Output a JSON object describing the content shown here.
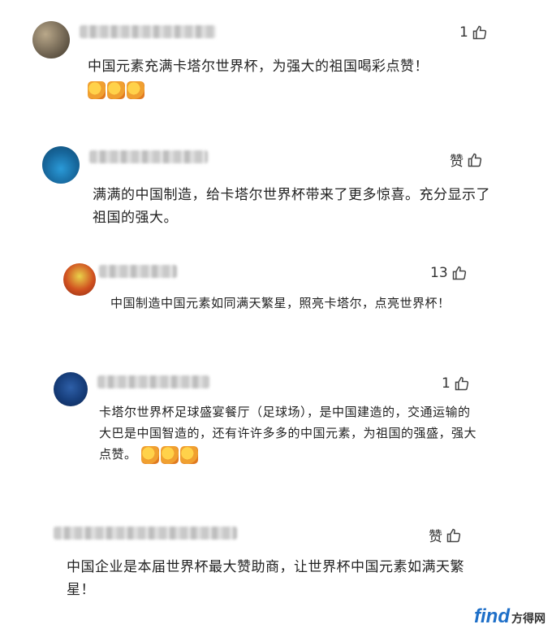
{
  "comments": [
    {
      "likes": "1",
      "text": "中国元素充满卡塔尔世界杯，为强大的祖国喝彩点赞！",
      "emoji": [
        "thumbs-up-emoji",
        "thumbs-up-emoji",
        "thumbs-up-emoji"
      ]
    },
    {
      "likes": "赞",
      "text": "满满的中国制造，给卡塔尔世界杯带来了更多惊喜。充分显示了祖国的强大。"
    },
    {
      "likes": "13",
      "text": "中国制造中国元素如同满天繁星，照亮卡塔尔，点亮世界杯！"
    },
    {
      "likes": "1",
      "text": "卡塔尔世界杯足球盛宴餐厅（足球场），是中国建造的，交通运输的大巴是中国智造的，还有许许多多的中国元素，为祖国的强盛，强大点赞。",
      "emoji": [
        "thumbs-up-emoji",
        "thumbs-up-emoji",
        "thumbs-up-emoji"
      ]
    },
    {
      "likes": "赞",
      "text": "中国企业是本届世界杯最大赞助商，让世界杯中国元素如满天繁星！"
    }
  ],
  "watermark": {
    "logo": "find",
    "text": "方得网"
  },
  "colors": {
    "accent": "#1e6fc8",
    "text": "#222222",
    "blur": "#c9c9c9"
  }
}
